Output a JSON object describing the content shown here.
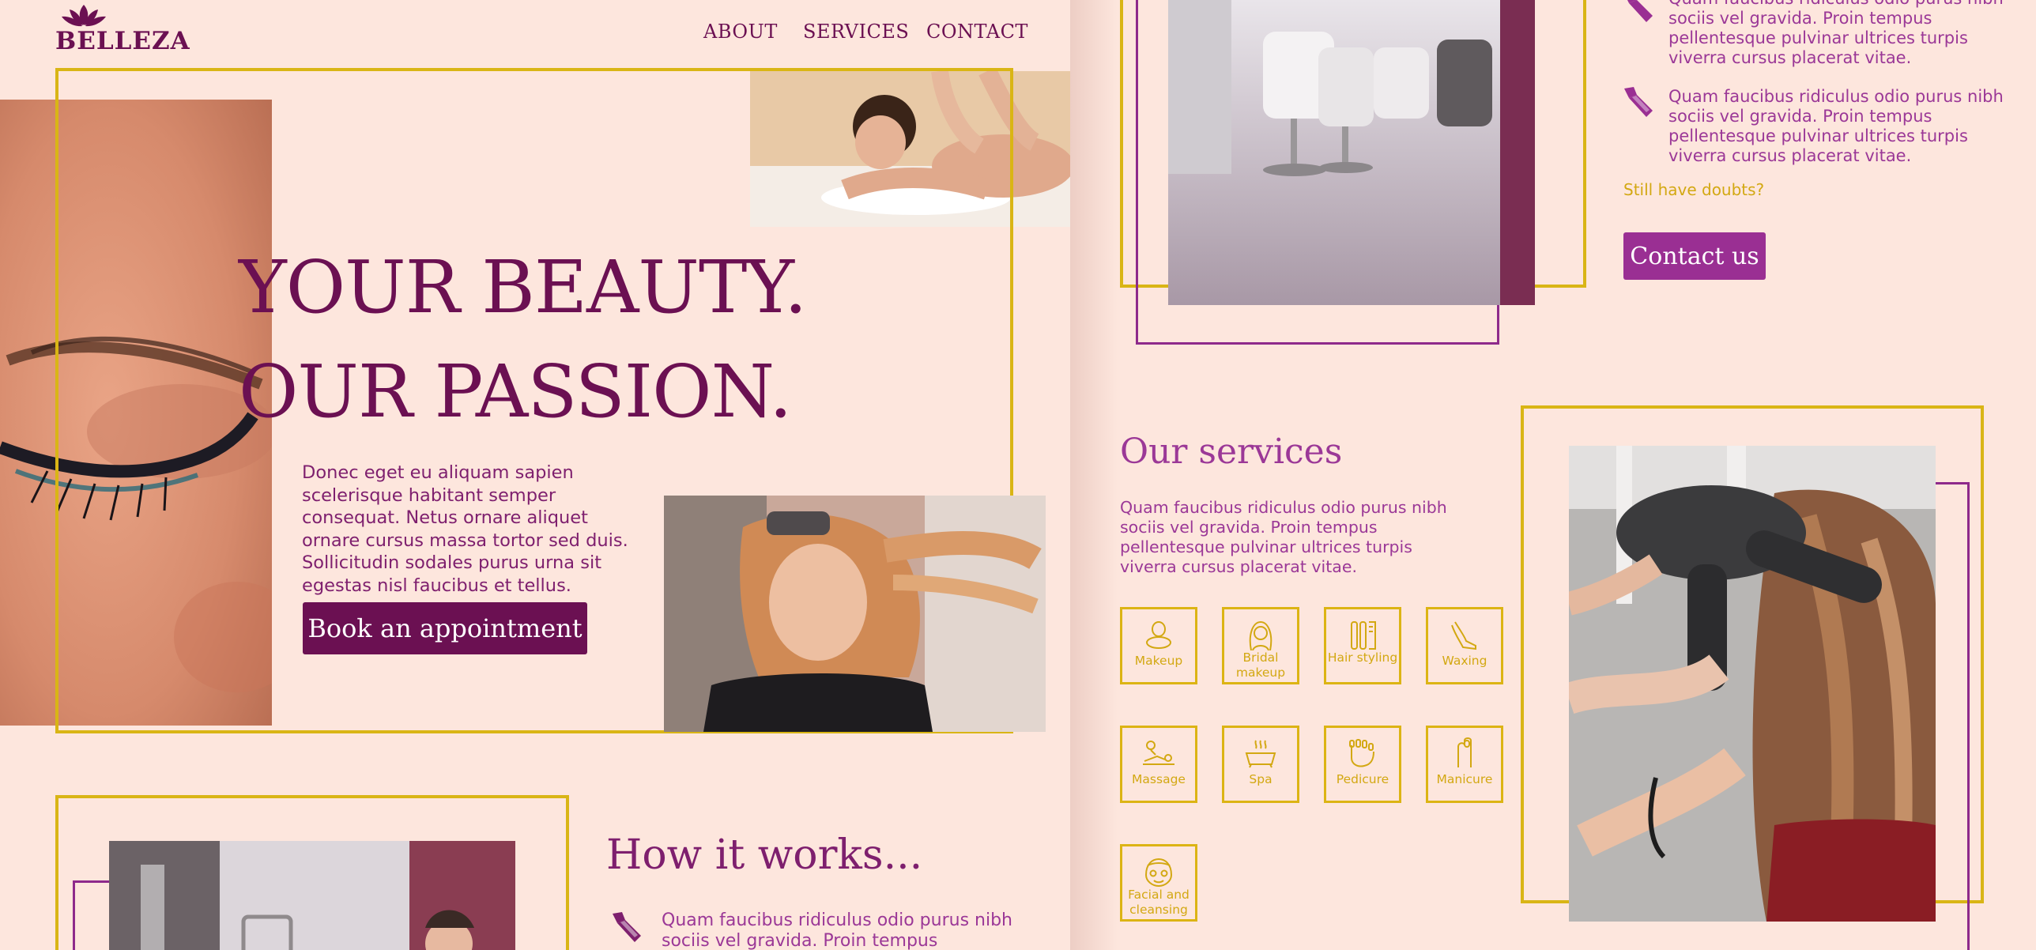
{
  "brand": {
    "name": "BELLEZA"
  },
  "nav": {
    "about": "ABOUT",
    "services": "SERVICES",
    "contact": "CONTACT"
  },
  "hero": {
    "line1": "YOUR BEAUTY.",
    "line2": "OUR PASSION.",
    "body": "Donec eget eu aliquam sapien scelerisque habitant semper consequat. Netus ornare aliquet ornare cursus massa tortor sed duis. Sollicitudin sodales purus urna sit egestas nisl faucibus et tellus.",
    "cta": "Book an appointment"
  },
  "how_it_works": {
    "title": "How it works...",
    "step_text": "Quam faucibus ridiculus odio purus nibh sociis vel gravida. Proin tempus pellentesque pulvinar ultrices turpis viverra cursus placerat vitae.",
    "doubts": "Still have doubts?",
    "cta": "Contact us"
  },
  "services": {
    "title": "Our services",
    "body": "Quam faucibus ridiculus odio purus nibh sociis vel gravida. Proin tempus pellentesque pulvinar ultrices turpis viverra cursus placerat vitae.",
    "items": [
      {
        "label": "Makeup",
        "icon": "makeup-icon"
      },
      {
        "label": "Bridal makeup",
        "icon": "bride-icon"
      },
      {
        "label": "Hair styling",
        "icon": "hair-tools-icon"
      },
      {
        "label": "Waxing",
        "icon": "leg-icon"
      },
      {
        "label": "Massage",
        "icon": "massage-icon"
      },
      {
        "label": "Spa",
        "icon": "bathtub-icon"
      },
      {
        "label": "Pedicure",
        "icon": "foot-icon"
      },
      {
        "label": "Manicure",
        "icon": "hand-icon"
      },
      {
        "label": "Facial and cleansing",
        "icon": "face-mask-icon"
      }
    ]
  },
  "colors": {
    "background": "#fde6dd",
    "brand_purple": "#6b1052",
    "accent_purple": "#9a2f93",
    "gold": "#d9b515"
  }
}
